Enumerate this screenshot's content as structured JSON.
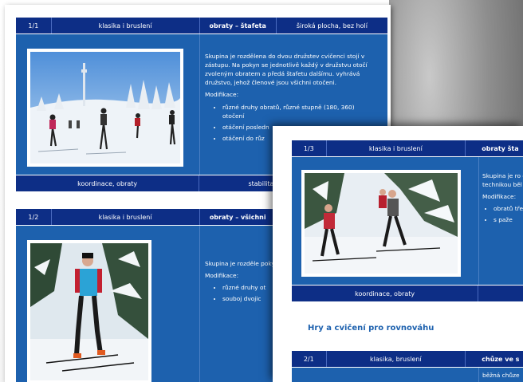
{
  "page1": {
    "card1": {
      "num": "1/1",
      "category": "klasika i bruslení",
      "title": "obraty – štafeta",
      "terrain": "široká plocha, bez holí",
      "description": "Skupina je rozdělena do dvou družstev cvičenci stojí v zástupu. Na pokyn se jednotlivě každý v družstvu otočí zvoleným obratem a předá štafetu dalšímu. vyhrává družstvo, jehož členové jsou všichni otočeni.",
      "modifications_label": "Modifikace:",
      "modifications": [
        "různé druhy obratů, různé stupně (180, 360) otočení",
        "otáčení posledn",
        "otáčení do růz"
      ],
      "focus": "koordinace, obraty",
      "focus2": "stabilita,"
    },
    "card2": {
      "num": "1/2",
      "category": "klasika i bruslení",
      "title": "obraty – všichni",
      "description": "Skupina je rozděle pokynu všichni člen rychlejší skupina",
      "modifications_label": "Modifikace:",
      "modifications": [
        "různé druhy ot",
        "souboj dvojic"
      ]
    }
  },
  "page2": {
    "card3": {
      "num": "1/3",
      "category": "klasika i bruslení",
      "title": "obraty šta",
      "description": "Skupina je ro cvičenci štafe technikou běl holí) vykonaj",
      "modifications_label": "Modifikace:",
      "modifications": [
        "obratů třetina",
        "s paže"
      ],
      "focus": "koordinace, obraty"
    },
    "section_title": "Hry a cvičení pro rovnováhu",
    "card4": {
      "num": "2/1",
      "category": "klasika, bruslení",
      "title": "chůze ve s",
      "description": "běžná chůze"
    }
  }
}
